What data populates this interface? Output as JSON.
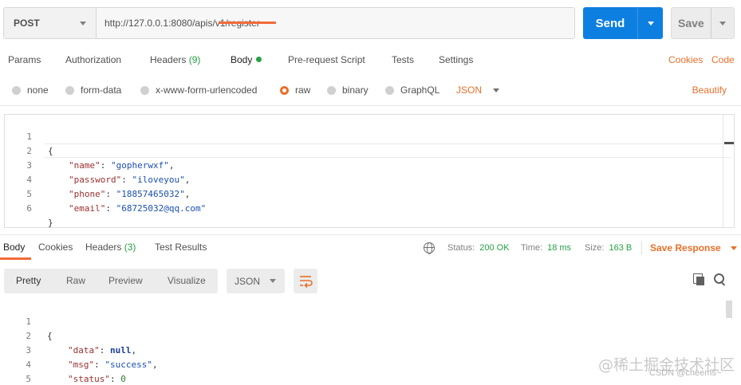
{
  "request": {
    "method": "POST",
    "url": "http://127.0.0.1:8080/apis/v1/register",
    "send_label": "Send",
    "save_label": "Save"
  },
  "request_tabs": {
    "params": "Params",
    "authorization": "Authorization",
    "headers": "Headers",
    "headers_count": "(9)",
    "body": "Body",
    "prerequest": "Pre-request Script",
    "tests": "Tests",
    "settings": "Settings",
    "cookies": "Cookies",
    "code": "Code"
  },
  "body_types": {
    "none": "none",
    "form_data": "form-data",
    "urlencoded": "x-www-form-urlencoded",
    "raw": "raw",
    "binary": "binary",
    "graphql": "GraphQL",
    "language": "JSON",
    "beautify": "Beautify"
  },
  "request_body": {
    "line_numbers": [
      "1",
      "2",
      "3",
      "4",
      "5",
      "6"
    ],
    "open_brace": "{",
    "close_brace": "}",
    "fields": [
      {
        "key": "\"name\"",
        "value": "\"gopherwxf\"",
        "sep": ": ",
        "end": ","
      },
      {
        "key": "\"password\"",
        "value": "\"iloveyou\"",
        "sep": ": ",
        "end": ","
      },
      {
        "key": "\"phone\"",
        "value": "\"18857465032\"",
        "sep": ": ",
        "end": ","
      },
      {
        "key": "\"email\"",
        "value": "\"68725032@qq.com\"",
        "sep": ": ",
        "end": ""
      }
    ]
  },
  "response_tabs": {
    "body": "Body",
    "cookies": "Cookies",
    "headers": "Headers",
    "headers_count": "(3)",
    "test_results": "Test Results"
  },
  "response_status": {
    "status_label": "Status:",
    "status_value": "200 OK",
    "time_label": "Time:",
    "time_value": "18 ms",
    "size_label": "Size:",
    "size_value": "163 B",
    "save_response": "Save Response"
  },
  "response_toolbar": {
    "pretty": "Pretty",
    "raw": "Raw",
    "preview": "Preview",
    "visualize": "Visualize",
    "format": "JSON"
  },
  "response_body": {
    "line_numbers": [
      "1",
      "2",
      "3",
      "4",
      "5"
    ],
    "open_brace": "{",
    "close_brace": "}",
    "data_key": "\"data\"",
    "data_value": "null",
    "msg_key": "\"msg\"",
    "msg_value": "\"success\"",
    "status_key": "\"status\"",
    "status_value": "0",
    "sep": ": ",
    "comma": ","
  },
  "watermark": {
    "line1": "@稀土掘金技术社区",
    "line2": "CSDN @cheems~"
  },
  "colors": {
    "accent": "#f26b3a",
    "send_blue": "#0d7fe0",
    "success_green": "#25a244"
  }
}
